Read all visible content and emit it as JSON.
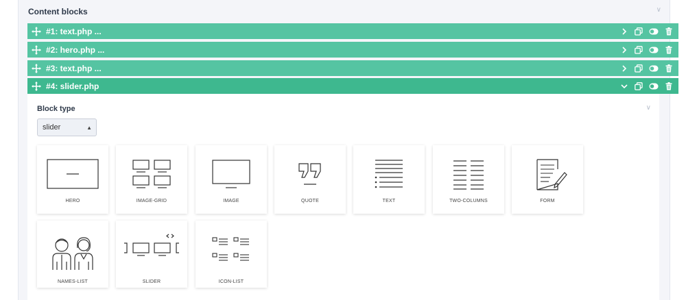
{
  "section": {
    "title": "Content blocks"
  },
  "blocks": [
    {
      "title": "#1: text.php ...",
      "expanded": false
    },
    {
      "title": "#2: hero.php ...",
      "expanded": false
    },
    {
      "title": "#3: text.php ...",
      "expanded": false
    },
    {
      "title": "#4: slider.php",
      "expanded": true
    }
  ],
  "editor": {
    "block_type_label": "Block type",
    "select_value": "slider",
    "types": [
      "HERO",
      "IMAGE-GRID",
      "IMAGE",
      "QUOTE",
      "TEXT",
      "TWO-COLUMNS",
      "FORM",
      "NAMES-LIST",
      "SLIDER",
      "ICON-LIST"
    ]
  },
  "colors": {
    "header": "#55c4a2",
    "header_active": "#3eb88f"
  },
  "icons": [
    "move-icon",
    "chevron-right-icon",
    "chevron-down-icon",
    "duplicate-icon",
    "toggle-icon",
    "trash-icon"
  ]
}
